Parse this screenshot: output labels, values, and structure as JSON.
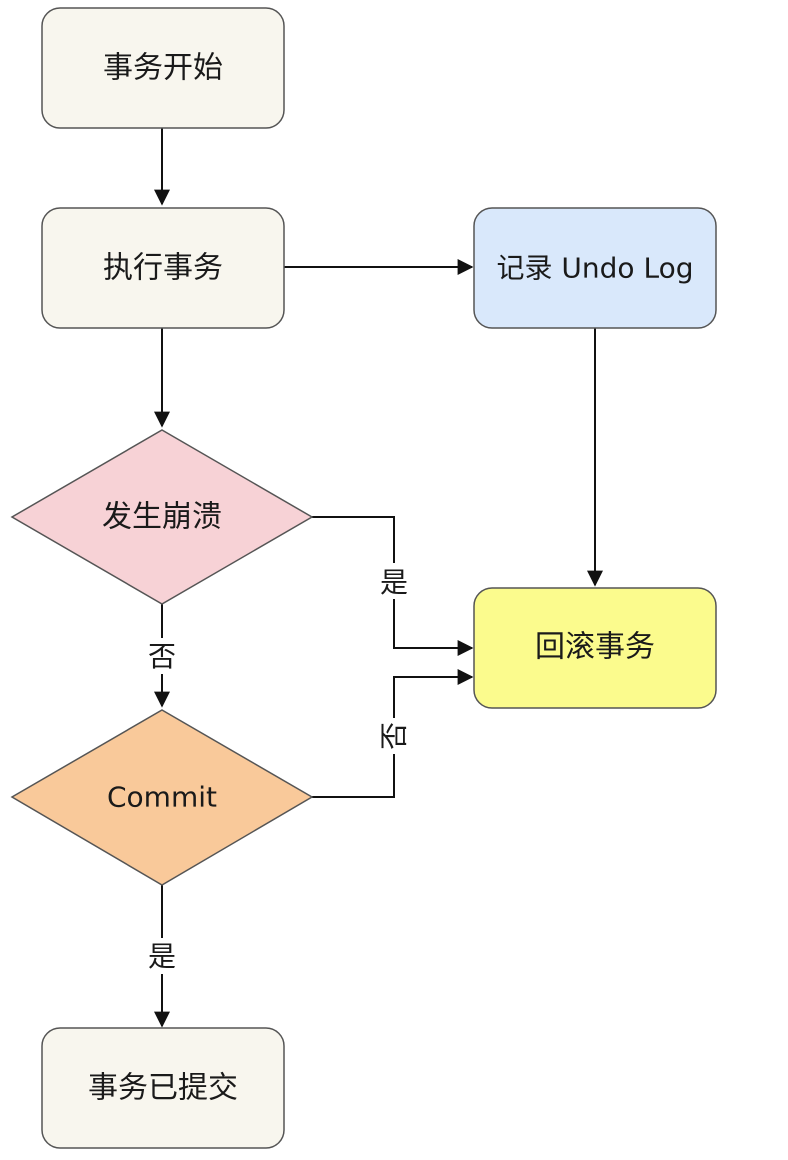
{
  "nodes": {
    "start": {
      "label": "事务开始",
      "fill": "#f8f6ee"
    },
    "execute": {
      "label": "执行事务",
      "fill": "#f8f6ee"
    },
    "undo_log": {
      "label": "记录 Undo Log",
      "fill": "#d9e8fb"
    },
    "crash": {
      "label": "发生崩溃",
      "fill": "#f7d2d6"
    },
    "rollback": {
      "label": "回滚事务",
      "fill": "#fbfb8d"
    },
    "commit": {
      "label": "Commit",
      "fill": "#f9c99a"
    },
    "committed": {
      "label": "事务已提交",
      "fill": "#f8f6ee"
    }
  },
  "edges": {
    "crash_yes": "是",
    "crash_no": "否",
    "commit_no": "否",
    "commit_yes": "是"
  }
}
